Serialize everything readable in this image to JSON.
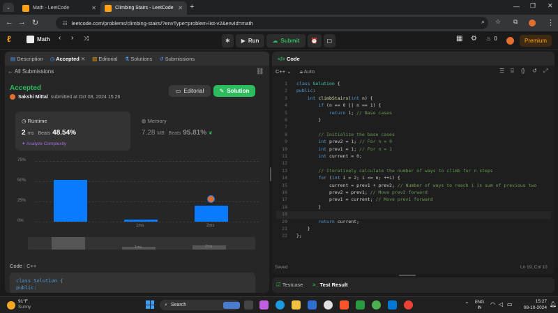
{
  "browser": {
    "tabs": [
      {
        "title": "Math - LeetCode",
        "active": false
      },
      {
        "title": "Climbing Stairs - LeetCode",
        "active": true
      }
    ],
    "url": "leetcode.com/problems/climbing-stairs/?envType=problem-list-v2&envId=math"
  },
  "lc_nav": {
    "problem_list": "Math",
    "run_label": "Run",
    "submit_label": "Submit",
    "fire_count": "0",
    "premium_label": "Premium"
  },
  "left_panel": {
    "tabs": [
      "Description",
      "Accepted",
      "Editorial",
      "Solutions",
      "Submissions"
    ],
    "back_label": "All Submissions",
    "status": "Accepted",
    "user": "Sakshi Mittal",
    "submitted_text": "submitted at Oct 08, 2024 15:26",
    "editorial_btn": "Editorial",
    "solution_btn": "Solution",
    "runtime": {
      "label": "Runtime",
      "value": "2",
      "unit": "ms",
      "beats_label": "Beats",
      "beats": "48.54%",
      "analyze": "Analyze Complexity"
    },
    "memory": {
      "label": "Memory",
      "value": "7.28",
      "unit": "MB",
      "beats_label": "Beats",
      "beats": "95.81%"
    },
    "code_label": "Code",
    "lang_label": "C++",
    "code_preview": [
      "class Solution {",
      "public:"
    ]
  },
  "chart_data": {
    "type": "bar",
    "categories": [
      "",
      "1ms",
      "2ms"
    ],
    "values": [
      52,
      2.5,
      20
    ],
    "ylim": [
      0,
      75
    ],
    "yticks": [
      "75%",
      "50%",
      "25%",
      "0%"
    ],
    "highlight_index": 2,
    "overview_labels": [
      "1ms",
      "2ms"
    ]
  },
  "editor": {
    "title": "Code",
    "lang": "C++",
    "mode": "Auto",
    "status": "Saved",
    "cursor": "Ln 19, Col 10"
  },
  "code_lines": [
    [
      [
        "kw",
        "class "
      ],
      [
        "ty",
        "Solution"
      ],
      [
        "pl",
        " {"
      ]
    ],
    [
      [
        "kw",
        "public"
      ],
      [
        "pl",
        ":"
      ]
    ],
    [
      [
        "pl",
        "    "
      ],
      [
        "kw",
        "int "
      ],
      [
        "fn",
        "climbStairs"
      ],
      [
        "pl",
        "("
      ],
      [
        "kw",
        "int"
      ],
      [
        "pl",
        " n) {"
      ]
    ],
    [
      [
        "pl",
        "        "
      ],
      [
        "kw",
        "if"
      ],
      [
        "pl",
        " (n == "
      ],
      [
        "nu",
        "0"
      ],
      [
        "pl",
        " || n == "
      ],
      [
        "nu",
        "1"
      ],
      [
        "pl",
        ") {"
      ]
    ],
    [
      [
        "pl",
        "            "
      ],
      [
        "kw",
        "return "
      ],
      [
        "nu",
        "1"
      ],
      [
        "pl",
        "; "
      ],
      [
        "cm",
        "// Base cases"
      ]
    ],
    [
      [
        "pl",
        "        }"
      ]
    ],
    [
      [
        "pl",
        ""
      ]
    ],
    [
      [
        "pl",
        "        "
      ],
      [
        "cm",
        "// Initialize the base cases"
      ]
    ],
    [
      [
        "pl",
        "        "
      ],
      [
        "kw",
        "int"
      ],
      [
        "pl",
        " prev2 = "
      ],
      [
        "nu",
        "1"
      ],
      [
        "pl",
        "; "
      ],
      [
        "cm",
        "// For n = 0"
      ]
    ],
    [
      [
        "pl",
        "        "
      ],
      [
        "kw",
        "int"
      ],
      [
        "pl",
        " prev1 = "
      ],
      [
        "nu",
        "1"
      ],
      [
        "pl",
        "; "
      ],
      [
        "cm",
        "// For n = 1"
      ]
    ],
    [
      [
        "pl",
        "        "
      ],
      [
        "kw",
        "int"
      ],
      [
        "pl",
        " current = "
      ],
      [
        "nu",
        "0"
      ],
      [
        "pl",
        ";"
      ]
    ],
    [
      [
        "pl",
        ""
      ]
    ],
    [
      [
        "pl",
        "        "
      ],
      [
        "cm",
        "// Iteratively calculate the number of ways to climb for n steps"
      ]
    ],
    [
      [
        "pl",
        "        "
      ],
      [
        "kw",
        "for"
      ],
      [
        "pl",
        " ("
      ],
      [
        "kw",
        "int"
      ],
      [
        "pl",
        " i = "
      ],
      [
        "nu",
        "2"
      ],
      [
        "pl",
        "; i <= n; ++i) {"
      ]
    ],
    [
      [
        "pl",
        "            current = prev1 + prev2; "
      ],
      [
        "cm",
        "// Number of ways to reach i is sum of previous two"
      ]
    ],
    [
      [
        "pl",
        "            prev2 = prev1; "
      ],
      [
        "cm",
        "// Move prev2 forward"
      ]
    ],
    [
      [
        "pl",
        "            prev1 = current; "
      ],
      [
        "cm",
        "// Move prev1 forward"
      ]
    ],
    [
      [
        "pl",
        "        }"
      ]
    ],
    [
      [
        "pl",
        ""
      ]
    ],
    [
      [
        "pl",
        "        "
      ],
      [
        "kw",
        "return"
      ],
      [
        "pl",
        " current;"
      ]
    ],
    [
      [
        "pl",
        "    }"
      ]
    ],
    [
      [
        "pl",
        "};"
      ]
    ]
  ],
  "bottom_panel": {
    "testcase": "Testcase",
    "result": "Test Result"
  },
  "taskbar": {
    "weather_temp": "91°F",
    "weather_text": "Sunny",
    "search_placeholder": "Search",
    "lang_top": "ENG",
    "lang_bottom": "IN",
    "time": "15:27",
    "date": "08-10-2024"
  }
}
